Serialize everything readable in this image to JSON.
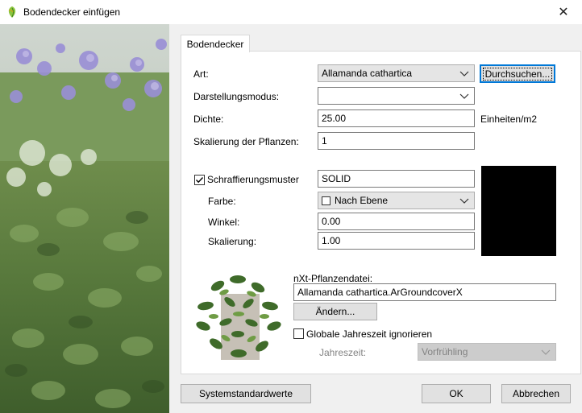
{
  "window": {
    "title": "Bodendecker einfügen",
    "close_glyph": "✕"
  },
  "tab": {
    "label": "Bodendecker"
  },
  "form": {
    "art": {
      "label": "Art:",
      "value": "Allamanda cathartica"
    },
    "browse_button": "Durchsuchen...",
    "darstellung": {
      "label": "Darstellungsmodus:",
      "value": ""
    },
    "dichte": {
      "label": "Dichte:",
      "value": "25.00",
      "unit": "Einheiten/m2"
    },
    "skalierung_pflanzen": {
      "label": "Skalierung der Pflanzen:",
      "value": "1"
    }
  },
  "hatch": {
    "checkbox_label": "Schraffierungsmuster",
    "checked": true,
    "pattern": "SOLID",
    "farbe": {
      "label": "Farbe:",
      "value": "Nach Ebene"
    },
    "winkel": {
      "label": "Winkel:",
      "value": "0.00"
    },
    "skalierung": {
      "label": "Skalierung:",
      "value": "1.00"
    },
    "preview_color": "#000000"
  },
  "nxt": {
    "label": "nXt-Pflanzendatei:",
    "file": "Allamanda cathartica.ArGroundcoverX",
    "change_button": "Ändern...",
    "season_checkbox_label": "Globale Jahreszeit ignorieren",
    "season_checked": false,
    "season_label": "Jahreszeit:",
    "season_value": "Vorfrühling"
  },
  "footer": {
    "defaults_button": "Systemstandardwerte",
    "ok_button": "OK",
    "cancel_button": "Abbrechen"
  },
  "icons": [
    "app-leaf-icon",
    "close-icon",
    "chevron-down-icon",
    "checkmark-icon"
  ],
  "colors": {
    "focus_blue": "#0078d7",
    "disabled_gray": "#cccccc"
  }
}
